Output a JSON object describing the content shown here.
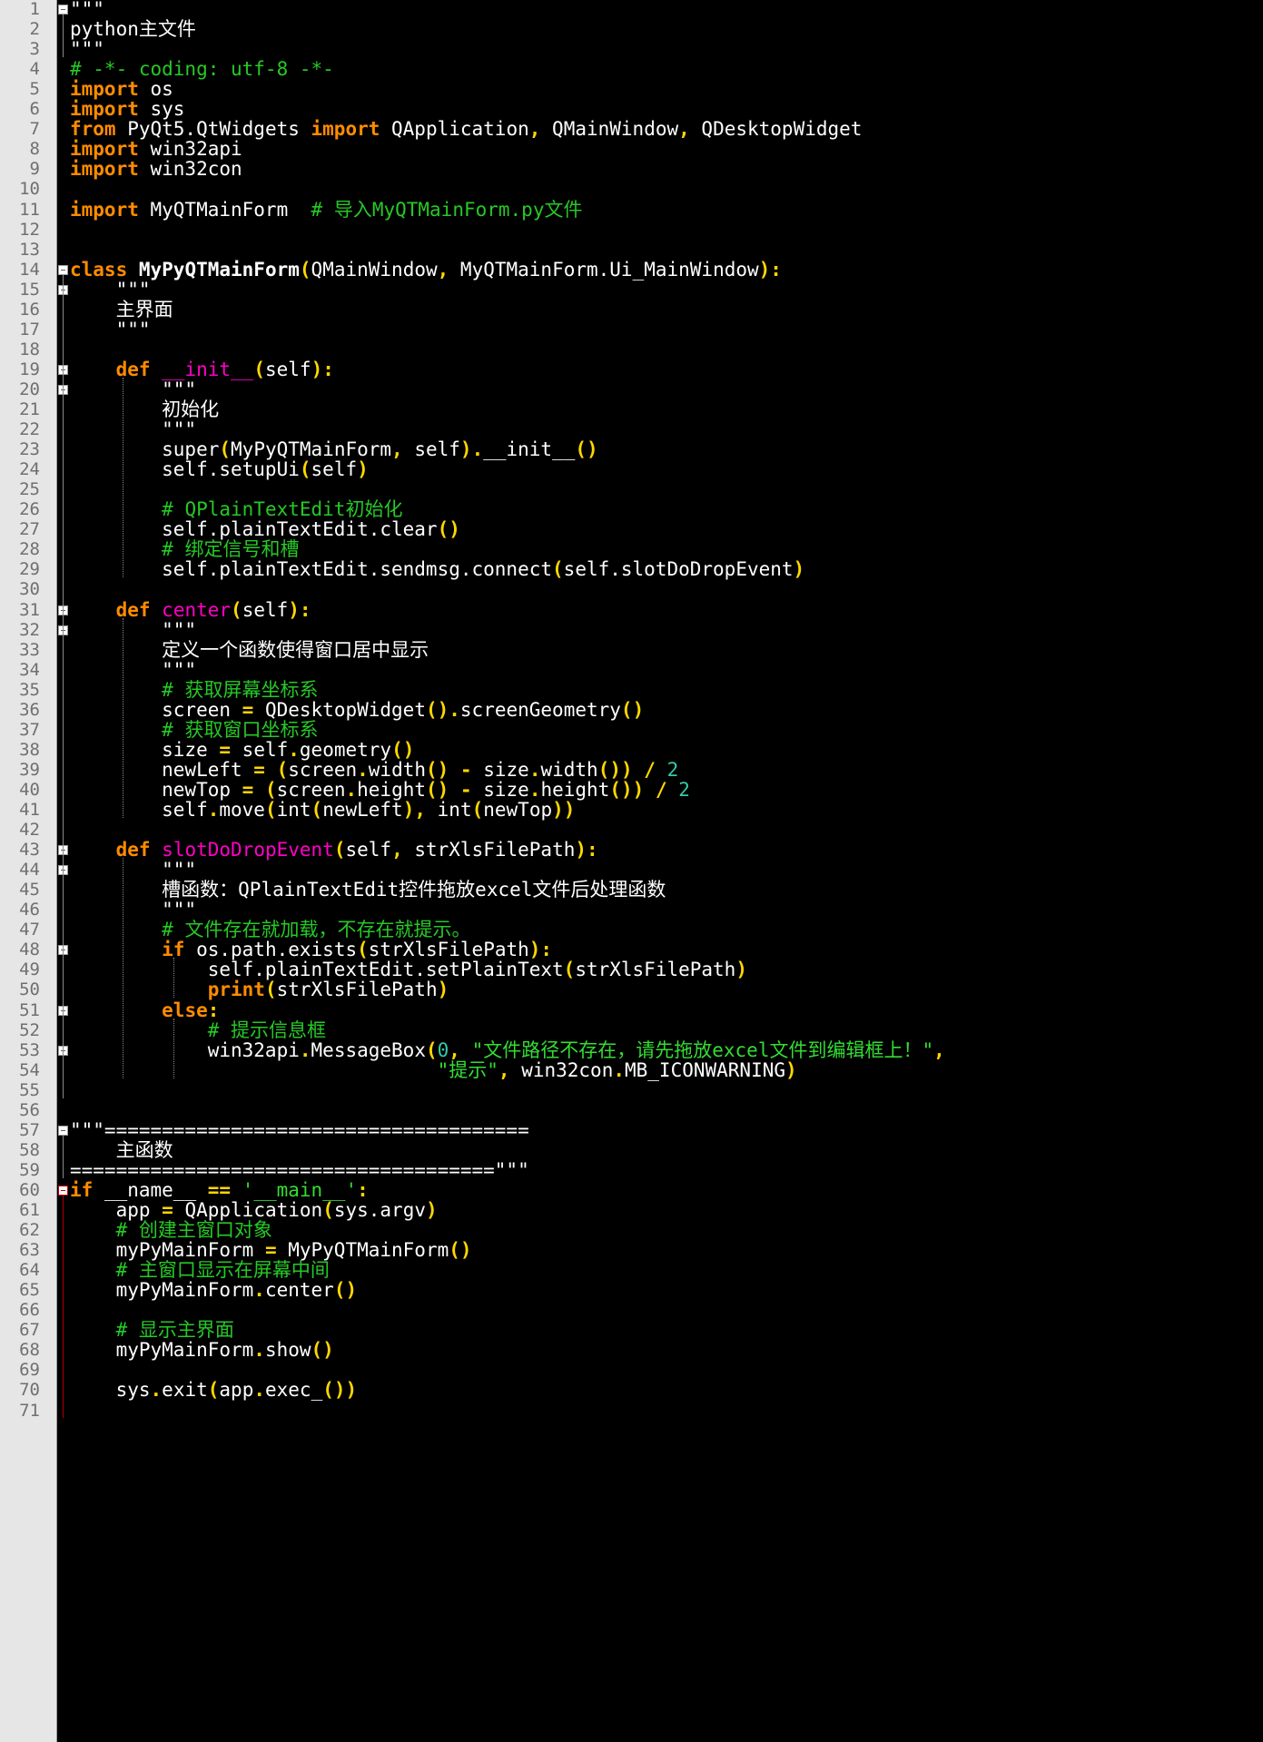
{
  "editor": {
    "colors": {
      "background": "#000000",
      "gutter": "#e6e6e6",
      "keyword": "#ff8c00",
      "function_name": "#ff00c8",
      "operator": "#ffd700",
      "comment": "#26c926",
      "string": "#33dd33",
      "number": "#33ccaa",
      "text": "#ffffff"
    },
    "icons": [
      "fold-minus-icon"
    ],
    "lines": [
      [
        [
          "tx",
          "\"\"\""
        ]
      ],
      [
        [
          "tx",
          "python主文件"
        ]
      ],
      [
        [
          "tx",
          "\"\"\""
        ]
      ],
      [
        [
          "cm",
          "# -*- coding: utf-8 -*-"
        ]
      ],
      [
        [
          "kw",
          "import"
        ],
        [
          "tx",
          " os"
        ]
      ],
      [
        [
          "kw",
          "import"
        ],
        [
          "tx",
          " sys"
        ]
      ],
      [
        [
          "kw",
          "from"
        ],
        [
          "tx",
          " PyQt5.QtWidgets "
        ],
        [
          "kw",
          "import"
        ],
        [
          "tx",
          " QApplication"
        ],
        [
          "op",
          ","
        ],
        [
          "tx",
          " QMainWindow"
        ],
        [
          "op",
          ","
        ],
        [
          "tx",
          " QDesktopWidget"
        ]
      ],
      [
        [
          "kw",
          "import"
        ],
        [
          "tx",
          " win32api"
        ]
      ],
      [
        [
          "kw",
          "import"
        ],
        [
          "tx",
          " win32con"
        ]
      ],
      [],
      [
        [
          "kw",
          "import"
        ],
        [
          "tx",
          " MyQTMainForm  "
        ],
        [
          "cm",
          "# 导入MyQTMainForm.py文件"
        ]
      ],
      [],
      [],
      [
        [
          "kw",
          "class"
        ],
        [
          "tx",
          " "
        ],
        [
          "cls",
          "MyPyQTMainForm"
        ],
        [
          "op",
          "("
        ],
        [
          "tx",
          "QMainWindow"
        ],
        [
          "op",
          ","
        ],
        [
          "tx",
          " MyQTMainForm.Ui_MainWindow"
        ],
        [
          "op",
          "):"
        ]
      ],
      [
        [
          "tx",
          "    \"\"\""
        ]
      ],
      [
        [
          "tx",
          "    主界面"
        ]
      ],
      [
        [
          "tx",
          "    \"\"\""
        ]
      ],
      [],
      [
        [
          "tx",
          "    "
        ],
        [
          "kw",
          "def"
        ],
        [
          "tx",
          " "
        ],
        [
          "fn",
          "__init__"
        ],
        [
          "op",
          "("
        ],
        [
          "tx",
          "self"
        ],
        [
          "op",
          "):"
        ]
      ],
      [
        [
          "tx",
          "        \"\"\""
        ]
      ],
      [
        [
          "tx",
          "        初始化"
        ]
      ],
      [
        [
          "tx",
          "        \"\"\""
        ]
      ],
      [
        [
          "tx",
          "        super"
        ],
        [
          "op",
          "("
        ],
        [
          "tx",
          "MyPyQTMainForm"
        ],
        [
          "op",
          ","
        ],
        [
          "tx",
          " self"
        ],
        [
          "op",
          ")."
        ],
        [
          "tx",
          "__init__"
        ],
        [
          "op",
          "()"
        ]
      ],
      [
        [
          "tx",
          "        self.setupUi"
        ],
        [
          "op",
          "("
        ],
        [
          "tx",
          "self"
        ],
        [
          "op",
          ")"
        ]
      ],
      [],
      [
        [
          "tx",
          "        "
        ],
        [
          "cm",
          "# QPlainTextEdit初始化"
        ]
      ],
      [
        [
          "tx",
          "        self.plainTextEdit.clear"
        ],
        [
          "op",
          "()"
        ]
      ],
      [
        [
          "tx",
          "        "
        ],
        [
          "cm",
          "# 绑定信号和槽"
        ]
      ],
      [
        [
          "tx",
          "        self.plainTextEdit.sendmsg.connect"
        ],
        [
          "op",
          "("
        ],
        [
          "tx",
          "self.slotDoDropEvent"
        ],
        [
          "op",
          ")"
        ]
      ],
      [],
      [
        [
          "tx",
          "    "
        ],
        [
          "kw",
          "def"
        ],
        [
          "tx",
          " "
        ],
        [
          "fn",
          "center"
        ],
        [
          "op",
          "("
        ],
        [
          "tx",
          "self"
        ],
        [
          "op",
          "):"
        ]
      ],
      [
        [
          "tx",
          "        \"\"\""
        ]
      ],
      [
        [
          "tx",
          "        定义一个函数使得窗口居中显示"
        ]
      ],
      [
        [
          "tx",
          "        \"\"\""
        ]
      ],
      [
        [
          "tx",
          "        "
        ],
        [
          "cm",
          "# 获取屏幕坐标系"
        ]
      ],
      [
        [
          "tx",
          "        screen "
        ],
        [
          "op",
          "="
        ],
        [
          "tx",
          " QDesktopWidget"
        ],
        [
          "op",
          "()."
        ],
        [
          "tx",
          "screenGeometry"
        ],
        [
          "op",
          "()"
        ]
      ],
      [
        [
          "tx",
          "        "
        ],
        [
          "cm",
          "# 获取窗口坐标系"
        ]
      ],
      [
        [
          "tx",
          "        size "
        ],
        [
          "op",
          "="
        ],
        [
          "tx",
          " self"
        ],
        [
          "op",
          "."
        ],
        [
          "tx",
          "geometry"
        ],
        [
          "op",
          "()"
        ]
      ],
      [
        [
          "tx",
          "        newLeft "
        ],
        [
          "op",
          "="
        ],
        [
          "tx",
          " "
        ],
        [
          "op",
          "("
        ],
        [
          "tx",
          "screen"
        ],
        [
          "op",
          "."
        ],
        [
          "tx",
          "width"
        ],
        [
          "op",
          "()"
        ],
        [
          "tx",
          " "
        ],
        [
          "op",
          "-"
        ],
        [
          "tx",
          " size"
        ],
        [
          "op",
          "."
        ],
        [
          "tx",
          "width"
        ],
        [
          "op",
          "())"
        ],
        [
          "tx",
          " "
        ],
        [
          "op",
          "/"
        ],
        [
          "tx",
          " "
        ],
        [
          "num",
          "2"
        ]
      ],
      [
        [
          "tx",
          "        newTop "
        ],
        [
          "op",
          "="
        ],
        [
          "tx",
          " "
        ],
        [
          "op",
          "("
        ],
        [
          "tx",
          "screen"
        ],
        [
          "op",
          "."
        ],
        [
          "tx",
          "height"
        ],
        [
          "op",
          "()"
        ],
        [
          "tx",
          " "
        ],
        [
          "op",
          "-"
        ],
        [
          "tx",
          " size"
        ],
        [
          "op",
          "."
        ],
        [
          "tx",
          "height"
        ],
        [
          "op",
          "())"
        ],
        [
          "tx",
          " "
        ],
        [
          "op",
          "/"
        ],
        [
          "tx",
          " "
        ],
        [
          "num",
          "2"
        ]
      ],
      [
        [
          "tx",
          "        self"
        ],
        [
          "op",
          "."
        ],
        [
          "tx",
          "move"
        ],
        [
          "op",
          "("
        ],
        [
          "tx",
          "int"
        ],
        [
          "op",
          "("
        ],
        [
          "tx",
          "newLeft"
        ],
        [
          "op",
          "),"
        ],
        [
          "tx",
          " int"
        ],
        [
          "op",
          "("
        ],
        [
          "tx",
          "newTop"
        ],
        [
          "op",
          "))"
        ]
      ],
      [],
      [
        [
          "tx",
          "    "
        ],
        [
          "kw",
          "def"
        ],
        [
          "tx",
          " "
        ],
        [
          "fn",
          "slotDoDropEvent"
        ],
        [
          "op",
          "("
        ],
        [
          "tx",
          "self"
        ],
        [
          "op",
          ","
        ],
        [
          "tx",
          " strXlsFilePath"
        ],
        [
          "op",
          "):"
        ]
      ],
      [
        [
          "tx",
          "        \"\"\""
        ]
      ],
      [
        [
          "tx",
          "        槽函数：QPlainTextEdit控件拖放excel文件后处理函数"
        ]
      ],
      [
        [
          "tx",
          "        \"\"\""
        ]
      ],
      [
        [
          "tx",
          "        "
        ],
        [
          "cm",
          "# 文件存在就加载，不存在就提示。"
        ]
      ],
      [
        [
          "tx",
          "        "
        ],
        [
          "kw",
          "if"
        ],
        [
          "tx",
          " os.path.exists"
        ],
        [
          "op",
          "("
        ],
        [
          "tx",
          "strXlsFilePath"
        ],
        [
          "op",
          "):"
        ]
      ],
      [
        [
          "tx",
          "            self.plainTextEdit.setPlainText"
        ],
        [
          "op",
          "("
        ],
        [
          "tx",
          "strXlsFilePath"
        ],
        [
          "op",
          ")"
        ]
      ],
      [
        [
          "tx",
          "            "
        ],
        [
          "kw",
          "print"
        ],
        [
          "op",
          "("
        ],
        [
          "tx",
          "strXlsFilePath"
        ],
        [
          "op",
          ")"
        ]
      ],
      [
        [
          "tx",
          "        "
        ],
        [
          "kw",
          "else"
        ],
        [
          "op",
          ":"
        ]
      ],
      [
        [
          "tx",
          "            "
        ],
        [
          "cm",
          "# 提示信息框"
        ]
      ],
      [
        [
          "tx",
          "            win32api"
        ],
        [
          "op",
          "."
        ],
        [
          "tx",
          "MessageBox"
        ],
        [
          "op",
          "("
        ],
        [
          "num",
          "0"
        ],
        [
          "op",
          ","
        ],
        [
          "tx",
          " "
        ],
        [
          "st",
          "\"文件路径不存在，请先拖放excel文件到编辑框上！\""
        ],
        [
          "op",
          ","
        ]
      ],
      [
        [
          "tx",
          "                                "
        ],
        [
          "st",
          "\"提示\""
        ],
        [
          "op",
          ","
        ],
        [
          "tx",
          " win32con"
        ],
        [
          "op",
          "."
        ],
        [
          "tx",
          "MB_ICONWARNING"
        ],
        [
          "op",
          ")"
        ]
      ],
      [],
      [],
      [
        [
          "tx",
          "\"\"\"====================================="
        ]
      ],
      [
        [
          "tx",
          "    主函数"
        ]
      ],
      [
        [
          "tx",
          "=====================================\"\"\""
        ]
      ],
      [
        [
          "kw",
          "if"
        ],
        [
          "tx",
          " __name__ "
        ],
        [
          "op",
          "=="
        ],
        [
          "tx",
          " "
        ],
        [
          "st",
          "'__main__'"
        ],
        [
          "op",
          ":"
        ]
      ],
      [
        [
          "tx",
          "    app "
        ],
        [
          "op",
          "="
        ],
        [
          "tx",
          " QApplication"
        ],
        [
          "op",
          "("
        ],
        [
          "tx",
          "sys.argv"
        ],
        [
          "op",
          ")"
        ]
      ],
      [
        [
          "tx",
          "    "
        ],
        [
          "cm",
          "# 创建主窗口对象"
        ]
      ],
      [
        [
          "tx",
          "    myPyMainForm "
        ],
        [
          "op",
          "="
        ],
        [
          "tx",
          " MyPyQTMainForm"
        ],
        [
          "op",
          "()"
        ]
      ],
      [
        [
          "tx",
          "    "
        ],
        [
          "cm",
          "# 主窗口显示在屏幕中间"
        ]
      ],
      [
        [
          "tx",
          "    myPyMainForm"
        ],
        [
          "op",
          "."
        ],
        [
          "tx",
          "center"
        ],
        [
          "op",
          "()"
        ]
      ],
      [],
      [
        [
          "tx",
          "    "
        ],
        [
          "cm",
          "# 显示主界面"
        ]
      ],
      [
        [
          "tx",
          "    myPyMainForm"
        ],
        [
          "op",
          "."
        ],
        [
          "tx",
          "show"
        ],
        [
          "op",
          "()"
        ]
      ],
      [],
      [
        [
          "tx",
          "    sys"
        ],
        [
          "op",
          "."
        ],
        [
          "tx",
          "exit"
        ],
        [
          "op",
          "("
        ],
        [
          "tx",
          "app"
        ],
        [
          "op",
          "."
        ],
        [
          "tx",
          "exec_"
        ],
        [
          "op",
          "())"
        ]
      ],
      []
    ]
  }
}
